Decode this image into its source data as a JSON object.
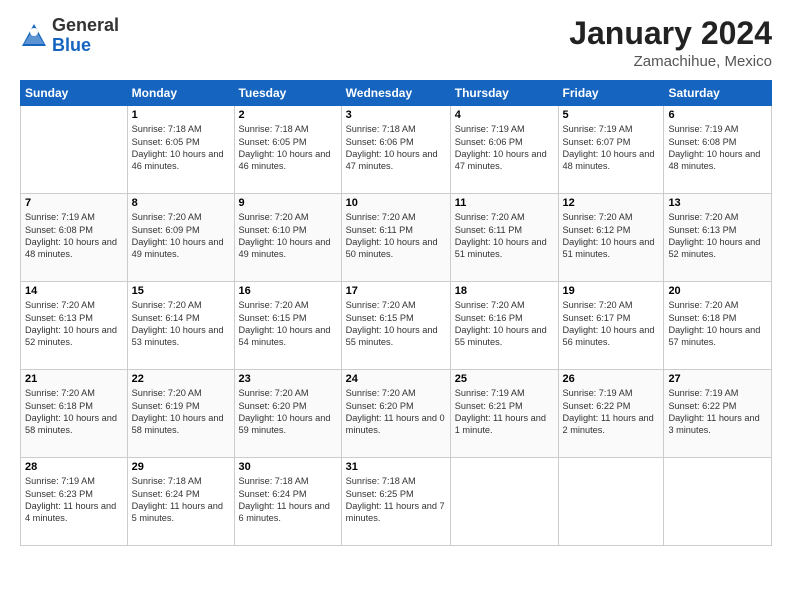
{
  "header": {
    "logo_general": "General",
    "logo_blue": "Blue",
    "month_title": "January 2024",
    "location": "Zamachihue, Mexico"
  },
  "days_of_week": [
    "Sunday",
    "Monday",
    "Tuesday",
    "Wednesday",
    "Thursday",
    "Friday",
    "Saturday"
  ],
  "weeks": [
    [
      {
        "day": "",
        "sunrise": "",
        "sunset": "",
        "daylight": ""
      },
      {
        "day": "1",
        "sunrise": "Sunrise: 7:18 AM",
        "sunset": "Sunset: 6:05 PM",
        "daylight": "Daylight: 10 hours and 46 minutes."
      },
      {
        "day": "2",
        "sunrise": "Sunrise: 7:18 AM",
        "sunset": "Sunset: 6:05 PM",
        "daylight": "Daylight: 10 hours and 46 minutes."
      },
      {
        "day": "3",
        "sunrise": "Sunrise: 7:18 AM",
        "sunset": "Sunset: 6:06 PM",
        "daylight": "Daylight: 10 hours and 47 minutes."
      },
      {
        "day": "4",
        "sunrise": "Sunrise: 7:19 AM",
        "sunset": "Sunset: 6:06 PM",
        "daylight": "Daylight: 10 hours and 47 minutes."
      },
      {
        "day": "5",
        "sunrise": "Sunrise: 7:19 AM",
        "sunset": "Sunset: 6:07 PM",
        "daylight": "Daylight: 10 hours and 48 minutes."
      },
      {
        "day": "6",
        "sunrise": "Sunrise: 7:19 AM",
        "sunset": "Sunset: 6:08 PM",
        "daylight": "Daylight: 10 hours and 48 minutes."
      }
    ],
    [
      {
        "day": "7",
        "sunrise": "Sunrise: 7:19 AM",
        "sunset": "Sunset: 6:08 PM",
        "daylight": "Daylight: 10 hours and 48 minutes."
      },
      {
        "day": "8",
        "sunrise": "Sunrise: 7:20 AM",
        "sunset": "Sunset: 6:09 PM",
        "daylight": "Daylight: 10 hours and 49 minutes."
      },
      {
        "day": "9",
        "sunrise": "Sunrise: 7:20 AM",
        "sunset": "Sunset: 6:10 PM",
        "daylight": "Daylight: 10 hours and 49 minutes."
      },
      {
        "day": "10",
        "sunrise": "Sunrise: 7:20 AM",
        "sunset": "Sunset: 6:11 PM",
        "daylight": "Daylight: 10 hours and 50 minutes."
      },
      {
        "day": "11",
        "sunrise": "Sunrise: 7:20 AM",
        "sunset": "Sunset: 6:11 PM",
        "daylight": "Daylight: 10 hours and 51 minutes."
      },
      {
        "day": "12",
        "sunrise": "Sunrise: 7:20 AM",
        "sunset": "Sunset: 6:12 PM",
        "daylight": "Daylight: 10 hours and 51 minutes."
      },
      {
        "day": "13",
        "sunrise": "Sunrise: 7:20 AM",
        "sunset": "Sunset: 6:13 PM",
        "daylight": "Daylight: 10 hours and 52 minutes."
      }
    ],
    [
      {
        "day": "14",
        "sunrise": "Sunrise: 7:20 AM",
        "sunset": "Sunset: 6:13 PM",
        "daylight": "Daylight: 10 hours and 52 minutes."
      },
      {
        "day": "15",
        "sunrise": "Sunrise: 7:20 AM",
        "sunset": "Sunset: 6:14 PM",
        "daylight": "Daylight: 10 hours and 53 minutes."
      },
      {
        "day": "16",
        "sunrise": "Sunrise: 7:20 AM",
        "sunset": "Sunset: 6:15 PM",
        "daylight": "Daylight: 10 hours and 54 minutes."
      },
      {
        "day": "17",
        "sunrise": "Sunrise: 7:20 AM",
        "sunset": "Sunset: 6:15 PM",
        "daylight": "Daylight: 10 hours and 55 minutes."
      },
      {
        "day": "18",
        "sunrise": "Sunrise: 7:20 AM",
        "sunset": "Sunset: 6:16 PM",
        "daylight": "Daylight: 10 hours and 55 minutes."
      },
      {
        "day": "19",
        "sunrise": "Sunrise: 7:20 AM",
        "sunset": "Sunset: 6:17 PM",
        "daylight": "Daylight: 10 hours and 56 minutes."
      },
      {
        "day": "20",
        "sunrise": "Sunrise: 7:20 AM",
        "sunset": "Sunset: 6:18 PM",
        "daylight": "Daylight: 10 hours and 57 minutes."
      }
    ],
    [
      {
        "day": "21",
        "sunrise": "Sunrise: 7:20 AM",
        "sunset": "Sunset: 6:18 PM",
        "daylight": "Daylight: 10 hours and 58 minutes."
      },
      {
        "day": "22",
        "sunrise": "Sunrise: 7:20 AM",
        "sunset": "Sunset: 6:19 PM",
        "daylight": "Daylight: 10 hours and 58 minutes."
      },
      {
        "day": "23",
        "sunrise": "Sunrise: 7:20 AM",
        "sunset": "Sunset: 6:20 PM",
        "daylight": "Daylight: 10 hours and 59 minutes."
      },
      {
        "day": "24",
        "sunrise": "Sunrise: 7:20 AM",
        "sunset": "Sunset: 6:20 PM",
        "daylight": "Daylight: 11 hours and 0 minutes."
      },
      {
        "day": "25",
        "sunrise": "Sunrise: 7:19 AM",
        "sunset": "Sunset: 6:21 PM",
        "daylight": "Daylight: 11 hours and 1 minute."
      },
      {
        "day": "26",
        "sunrise": "Sunrise: 7:19 AM",
        "sunset": "Sunset: 6:22 PM",
        "daylight": "Daylight: 11 hours and 2 minutes."
      },
      {
        "day": "27",
        "sunrise": "Sunrise: 7:19 AM",
        "sunset": "Sunset: 6:22 PM",
        "daylight": "Daylight: 11 hours and 3 minutes."
      }
    ],
    [
      {
        "day": "28",
        "sunrise": "Sunrise: 7:19 AM",
        "sunset": "Sunset: 6:23 PM",
        "daylight": "Daylight: 11 hours and 4 minutes."
      },
      {
        "day": "29",
        "sunrise": "Sunrise: 7:18 AM",
        "sunset": "Sunset: 6:24 PM",
        "daylight": "Daylight: 11 hours and 5 minutes."
      },
      {
        "day": "30",
        "sunrise": "Sunrise: 7:18 AM",
        "sunset": "Sunset: 6:24 PM",
        "daylight": "Daylight: 11 hours and 6 minutes."
      },
      {
        "day": "31",
        "sunrise": "Sunrise: 7:18 AM",
        "sunset": "Sunset: 6:25 PM",
        "daylight": "Daylight: 11 hours and 7 minutes."
      },
      {
        "day": "",
        "sunrise": "",
        "sunset": "",
        "daylight": ""
      },
      {
        "day": "",
        "sunrise": "",
        "sunset": "",
        "daylight": ""
      },
      {
        "day": "",
        "sunrise": "",
        "sunset": "",
        "daylight": ""
      }
    ]
  ]
}
